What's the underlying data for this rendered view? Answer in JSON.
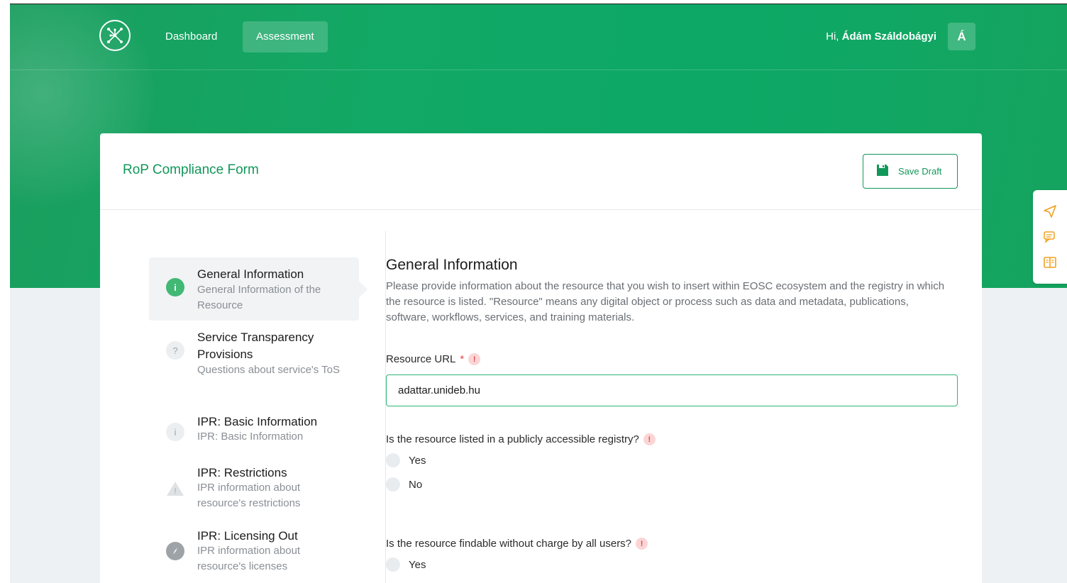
{
  "nav": {
    "links": [
      {
        "label": "Dashboard"
      },
      {
        "label": "Assessment"
      }
    ],
    "greeting_prefix": "Hi,",
    "user_name": "Ádám Száldobágyi",
    "avatar_letter": "Á"
  },
  "form": {
    "title": "RoP Compliance Form",
    "save_label": "Save Draft"
  },
  "steps": [
    {
      "title": "General Information",
      "subtitle": "General Information of the Resource",
      "icon": "info-icon",
      "active": true
    },
    {
      "title": "Service Transparency Provisions",
      "subtitle": "Questions about service's ToS",
      "icon": "question-icon"
    },
    {
      "title": "IPR: Basic Information",
      "subtitle": "IPR: Basic Information",
      "icon": "info-icon"
    },
    {
      "title": "IPR: Restrictions",
      "subtitle": "IPR information about resource's restrictions",
      "icon": "warning-icon"
    },
    {
      "title": "IPR: Licensing Out",
      "subtitle": "IPR information about resource's licenses",
      "icon": "compass-icon"
    }
  ],
  "section": {
    "title": "General Information",
    "description": "Please provide information about the resource that you wish to insert within EOSC ecosystem and the registry in which the resource is listed. \"Resource\" means any digital object or process such as data and metadata, publications, software, workflows, services, and training materials."
  },
  "fields": {
    "resource_url": {
      "label": "Resource URL",
      "required_mark": "*",
      "value": "adattar.unideb.hu"
    },
    "q1": {
      "label": "Is the resource listed in a publicly accessible registry?",
      "options": [
        "Yes",
        "No"
      ]
    },
    "q2": {
      "label": "Is the resource findable without charge by all users?",
      "options": [
        "Yes"
      ]
    }
  },
  "colors": {
    "accent": "#12975a",
    "hero": "#12a865",
    "warning": "#e04b4b",
    "side_icons": "#f0a020"
  }
}
